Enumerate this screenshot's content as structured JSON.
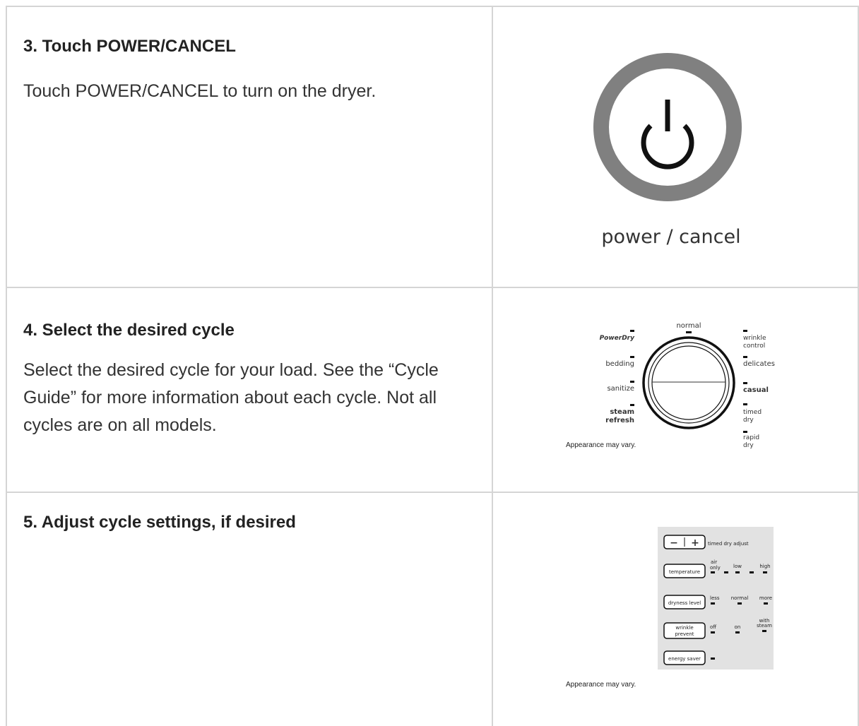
{
  "steps": [
    {
      "title": "3. Touch POWER/CANCEL",
      "body": "Touch POWER/CANCEL to turn on the dryer.",
      "image": {
        "label": "power / cancel",
        "icon": "power-icon"
      }
    },
    {
      "title": "4. Select the desired cycle",
      "body": "Select the desired cycle for your load. See the “Cycle Guide” for more information about each cycle. Not all cycles are on all models.",
      "image": {
        "caption": "Appearance may vary.",
        "top": "normal",
        "left": [
          "PowerDry",
          "bedding",
          "sanitize",
          "steam",
          "refresh"
        ],
        "right": [
          "wrinkle",
          "control",
          "delicates",
          "casual",
          "timed",
          "dry",
          "rapid",
          "dry"
        ]
      }
    },
    {
      "title": "5. Adjust cycle settings, if desired",
      "body": "",
      "image": {
        "caption": "Appearance may vary.",
        "minus": "−",
        "plus": "+",
        "timed_dry_adjust": "timed dry adjust",
        "temperature": {
          "button": "temperature",
          "options": [
            "air",
            "only",
            "low",
            "high"
          ]
        },
        "dryness": {
          "button": "dryness level",
          "options": [
            "less",
            "normal",
            "more"
          ]
        },
        "wrinkle": {
          "button": [
            "wrinkle",
            "prevent"
          ],
          "options": [
            "off",
            "on",
            "with",
            "steam"
          ]
        },
        "energy": {
          "button": "energy saver"
        }
      }
    }
  ],
  "colors": {
    "border": "#d5d5d5",
    "ring": "#808080",
    "panel": "#e2e2e2"
  }
}
